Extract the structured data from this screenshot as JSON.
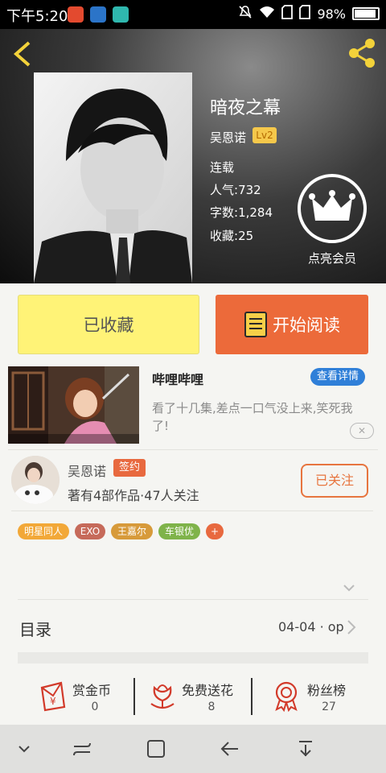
{
  "status_bar": {
    "time": "下午5:20",
    "battery": "98%"
  },
  "book": {
    "title": "暗夜之幕",
    "author": "吴恩诺",
    "level": "Lv2",
    "status": "连载",
    "popularity_label": "人气:",
    "popularity": "732",
    "words_label": "字数:",
    "words": "1,284",
    "favorites_label": "收藏:",
    "favorites": "25",
    "vip_label": "点亮会员"
  },
  "actions": {
    "favorited_label": "已收藏",
    "read_label": "开始阅读"
  },
  "ad": {
    "title": "哔哩哔哩",
    "detail_label": "查看详情",
    "description": "看了十几集,差点一口气没上来,笑死我了!"
  },
  "author_card": {
    "name": "吴恩诺",
    "badge": "签约",
    "works": "著有4部作品·47人关注",
    "follow_label": "已关注"
  },
  "tags": [
    {
      "label": "明星同人",
      "color": "#f2a838"
    },
    {
      "label": "EXO",
      "color": "#c66a5a"
    },
    {
      "label": "王嘉尔",
      "color": "#d79a3a"
    },
    {
      "label": "车银优",
      "color": "#7fb34a"
    },
    {
      "label": "+",
      "color": "#e8693f"
    }
  ],
  "toc": {
    "label": "目录",
    "latest": "04-04 · op"
  },
  "bottom_stats": [
    {
      "label": "赏金币",
      "value": "0",
      "icon": "coin-envelope-icon"
    },
    {
      "label": "免费送花",
      "value": "8",
      "icon": "flower-icon"
    },
    {
      "label": "粉丝榜",
      "value": "27",
      "icon": "medal-icon"
    }
  ],
  "colors": {
    "accent_orange": "#ec6a3a",
    "accent_yellow": "#fff377",
    "link_blue": "#2f7fd8",
    "icon_red": "#d23a2a"
  }
}
